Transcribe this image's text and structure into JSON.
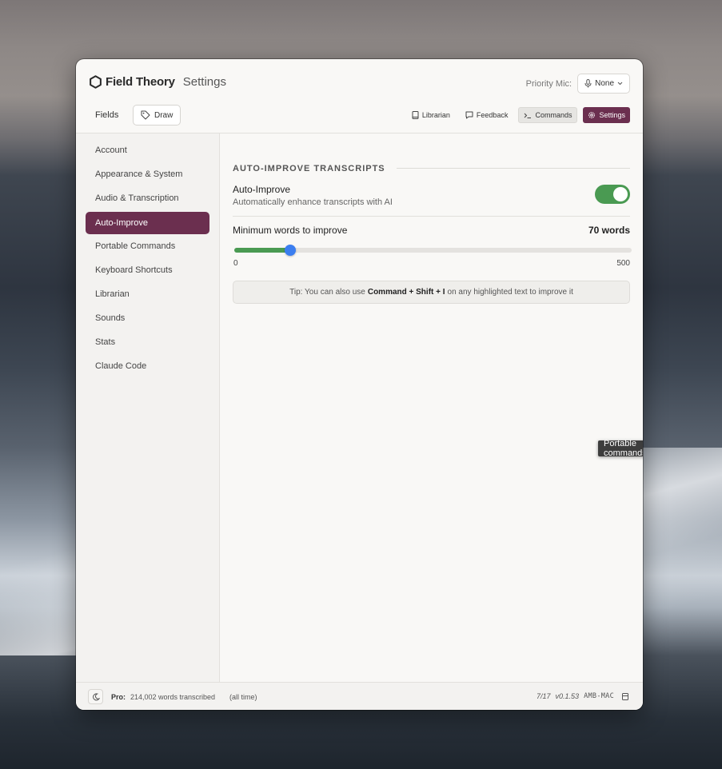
{
  "app": {
    "name": "Field Theory",
    "section": "Settings"
  },
  "mic": {
    "label": "Priority Mic:",
    "value": "None"
  },
  "toolbar": {
    "fields_label": "Fields",
    "draw_label": "Draw",
    "librarian_label": "Librarian",
    "feedback_label": "Feedback",
    "commands_label": "Commands",
    "settings_label": "Settings"
  },
  "sidebar": {
    "items": [
      {
        "label": "Account"
      },
      {
        "label": "Appearance & System"
      },
      {
        "label": "Audio & Transcription"
      },
      {
        "label": "Auto-Improve"
      },
      {
        "label": "Portable Commands"
      },
      {
        "label": "Keyboard Shortcuts"
      },
      {
        "label": "Librarian"
      },
      {
        "label": "Sounds"
      },
      {
        "label": "Stats"
      },
      {
        "label": "Claude Code"
      }
    ],
    "active": "Auto-Improve"
  },
  "main": {
    "section_title": "AUTO-IMPROVE TRANSCRIPTS",
    "auto_improve": {
      "title": "Auto-Improve",
      "description": "Automatically enhance transcripts with AI",
      "enabled": true
    },
    "min_words": {
      "label": "Minimum words to improve",
      "value_text": "70 words",
      "value": 70,
      "min": 0,
      "max": 500,
      "min_label": "0",
      "max_label": "500"
    },
    "tip": {
      "prefix": "Tip: You can also use",
      "shortcut": "Command + Shift + I",
      "suffix": "on any highlighted text to improve it"
    }
  },
  "tooltip": {
    "text": "Portable commands"
  },
  "footer": {
    "pro_label": "Pro:",
    "words_text": "214,002 words transcribed",
    "all_time": "(all time)",
    "date": "7/17",
    "version": "v0.1.53",
    "host": "AMB-MAC"
  },
  "colors": {
    "accent": "#6b2f4f",
    "toggle_on": "#4a9a52",
    "slider_thumb": "#3b7ef0"
  }
}
